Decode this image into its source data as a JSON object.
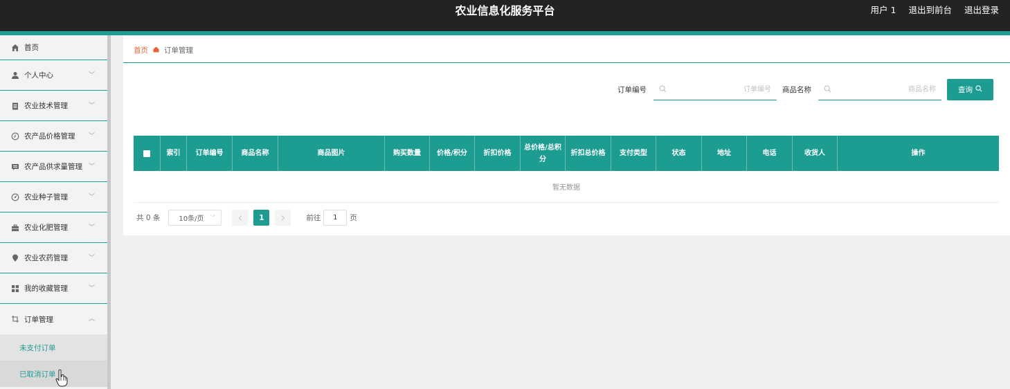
{
  "header": {
    "title": "农业信息化服务平台",
    "user": "用户 1",
    "to_front": "退出到前台",
    "logout": "退出登录"
  },
  "sidebar": {
    "home": "首页",
    "items": [
      {
        "label": "个人中心",
        "icon": "user-icon"
      },
      {
        "label": "农业技术管理",
        "icon": "clipboard-icon"
      },
      {
        "label": "农产品价格管理",
        "icon": "clock-icon"
      },
      {
        "label": "农产品供求量管理",
        "icon": "chat-icon"
      },
      {
        "label": "农业种子管理",
        "icon": "gauge-icon"
      },
      {
        "label": "农业化肥管理",
        "icon": "briefcase-icon"
      },
      {
        "label": "农业农药管理",
        "icon": "pin-icon"
      },
      {
        "label": "我的收藏管理",
        "icon": "grid-icon"
      },
      {
        "label": "订单管理",
        "icon": "crop-icon"
      }
    ],
    "sub_items": [
      "未支付订单",
      "已取消订单"
    ]
  },
  "breadcrumb": {
    "home": "首页",
    "current": "订单管理"
  },
  "search": {
    "order_no_label": "订单编号",
    "order_no_placeholder": "订单编号",
    "product_label": "商品名称",
    "product_placeholder": "商品名称",
    "button": "查询"
  },
  "table": {
    "columns": [
      "索引",
      "订单编号",
      "商品名称",
      "商品图片",
      "购买数量",
      "价格/积分",
      "折扣价格",
      "总价格/总积分",
      "折扣总价格",
      "支付类型",
      "状态",
      "地址",
      "电话",
      "收货人",
      "操作"
    ],
    "empty_text": "暂无数据"
  },
  "pagination": {
    "total": "共 0 条",
    "page_size": "10条/页",
    "current_page": "1",
    "goto_label": "前往",
    "goto_value": "1",
    "page_unit": "页"
  },
  "colors": {
    "accent": "#1d9c92",
    "header_bg": "#232323",
    "breadcrumb_home": "#e8613a"
  }
}
